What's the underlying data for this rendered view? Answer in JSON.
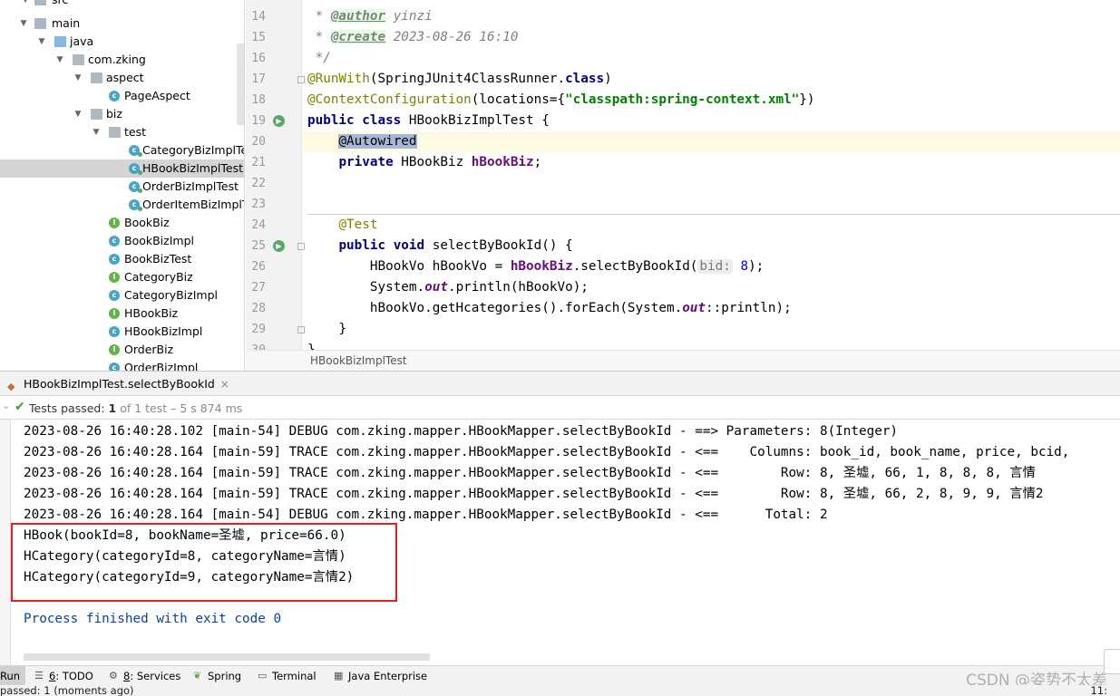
{
  "project_tree": {
    "items": [
      {
        "label": "src",
        "kind": "folder",
        "depth": 1,
        "expanded": true
      },
      {
        "label": "main",
        "kind": "folder",
        "depth": 2,
        "expanded": true
      },
      {
        "label": "java",
        "kind": "folder-blue",
        "depth": 3,
        "expanded": true
      },
      {
        "label": "com.zking",
        "kind": "package",
        "depth": 4,
        "expanded": true
      },
      {
        "label": "aspect",
        "kind": "package",
        "depth": 5,
        "expanded": true
      },
      {
        "label": "PageAspect",
        "kind": "class",
        "depth": 6
      },
      {
        "label": "biz",
        "kind": "package",
        "depth": 5,
        "expanded": true
      },
      {
        "label": "test",
        "kind": "package",
        "depth": 6,
        "expanded": true
      },
      {
        "label": "CategoryBizImplTes",
        "kind": "test",
        "depth": 7
      },
      {
        "label": "HBookBizImplTest",
        "kind": "test",
        "depth": 7,
        "selected": true
      },
      {
        "label": "OrderBizImplTest",
        "kind": "test",
        "depth": 7
      },
      {
        "label": "OrderItemBizImplTe",
        "kind": "test",
        "depth": 7
      },
      {
        "label": "BookBiz",
        "kind": "interface",
        "depth": 6
      },
      {
        "label": "BookBizImpl",
        "kind": "class",
        "depth": 6
      },
      {
        "label": "BookBizTest",
        "kind": "class",
        "depth": 6
      },
      {
        "label": "CategoryBiz",
        "kind": "interface",
        "depth": 6
      },
      {
        "label": "CategoryBizImpl",
        "kind": "class",
        "depth": 6
      },
      {
        "label": "HBookBiz",
        "kind": "interface",
        "depth": 6
      },
      {
        "label": "HBookBizImpl",
        "kind": "class",
        "depth": 6
      },
      {
        "label": "OrderBiz",
        "kind": "interface",
        "depth": 6
      },
      {
        "label": "OrderBizImpl",
        "kind": "class",
        "depth": 6
      }
    ]
  },
  "editor": {
    "line_numbers": [
      "14",
      "15",
      "16",
      "17",
      "18",
      "19",
      "20",
      "21",
      "22",
      "23",
      "24",
      "25",
      "26",
      "27",
      "28",
      "29",
      "30"
    ],
    "lines": {
      "l14_star": " * ",
      "l14_tag": "@author",
      "l14_text": " yinzi",
      "l15_star": " * ",
      "l15_tag": "@create",
      "l15_text": " 2023-08-26 16:10",
      "l16": " */",
      "l17_ann": "@RunWith",
      "l17_a": "(SpringJUnit4ClassRunner.",
      "l17_kw": "class",
      "l17_b": ")",
      "l18_ann": "@ContextConfiguration",
      "l18_a": "(locations={",
      "l18_str": "\"classpath:spring-context.xml\"",
      "l18_b": "})",
      "l19_kw": "public class",
      "l19_a": " HBookBizImplTest {",
      "l20_ann": "@Autowired",
      "l21_kw": "private",
      "l21_a": " HBookBiz ",
      "l21_fld": "hBookBiz",
      "l21_b": ";",
      "l24_ann": "@Test",
      "l25_kw": "public void",
      "l25_a": " selectByBookId() {",
      "l26_a": "HBookVo hBookVo = ",
      "l26_fld": "hBookBiz",
      "l26_b": ".selectByBookId(",
      "l26_hint": "bid:",
      "l26_num": "8",
      "l26_c": ");",
      "l27_a": "System.",
      "l27_fld": "out",
      "l27_b": ".println(hBookVo);",
      "l28_a": "hBookVo.getHcategories().forEach(System.",
      "l28_fld": "out",
      "l28_b": "::println);",
      "l29": "}",
      "l30": "}"
    },
    "breadcrumb": "HBookBizImplTest"
  },
  "run_panel": {
    "tab_label": "HBookBizImplTest.selectByBookId",
    "tab_close": "×",
    "status_prefix": "Tests passed: ",
    "status_count": "1",
    "status_rest": " of 1 test – 5 s 874 ms",
    "console_lines": [
      "2023-08-26 16:40:28.102 [main-54] DEBUG com.zking.mapper.HBookMapper.selectByBookId - ==> Parameters: 8(Integer)",
      "2023-08-26 16:40:28.164 [main-59] TRACE com.zking.mapper.HBookMapper.selectByBookId - <==    Columns: book_id, book_name, price, bcid,",
      "2023-08-26 16:40:28.164 [main-59] TRACE com.zking.mapper.HBookMapper.selectByBookId - <==        Row: 8, 圣墟, 66, 1, 8, 8, 8, 言情",
      "2023-08-26 16:40:28.164 [main-59] TRACE com.zking.mapper.HBookMapper.selectByBookId - <==        Row: 8, 圣墟, 66, 2, 8, 9, 9, 言情2",
      "2023-08-26 16:40:28.164 [main-54] DEBUG com.zking.mapper.HBookMapper.selectByBookId - <==      Total: 2",
      "HBook(bookId=8, bookName=圣墟, price=66.0)",
      "HCategory(categoryId=8, categoryName=言情)",
      "HCategory(categoryId=9, categoryName=言情2)",
      "",
      "Process finished with exit code 0"
    ]
  },
  "tool_windows": {
    "run": "Run",
    "todo_num": "6",
    "todo": ": TODO",
    "services_num": "8",
    "services": ": Services",
    "spring": "Spring",
    "terminal": "Terminal",
    "java_enterprise": "Java Enterprise"
  },
  "footer": {
    "status": "passed: 1 (moments ago)",
    "position": "11:"
  },
  "watermark": "CSDN @姿势不太差",
  "colors": {
    "keyword": "#000080",
    "annotation": "#808000",
    "string": "#008000",
    "field": "#660e7a",
    "highlight_box": "#e0201f",
    "process_text": "#0a3fa8"
  }
}
